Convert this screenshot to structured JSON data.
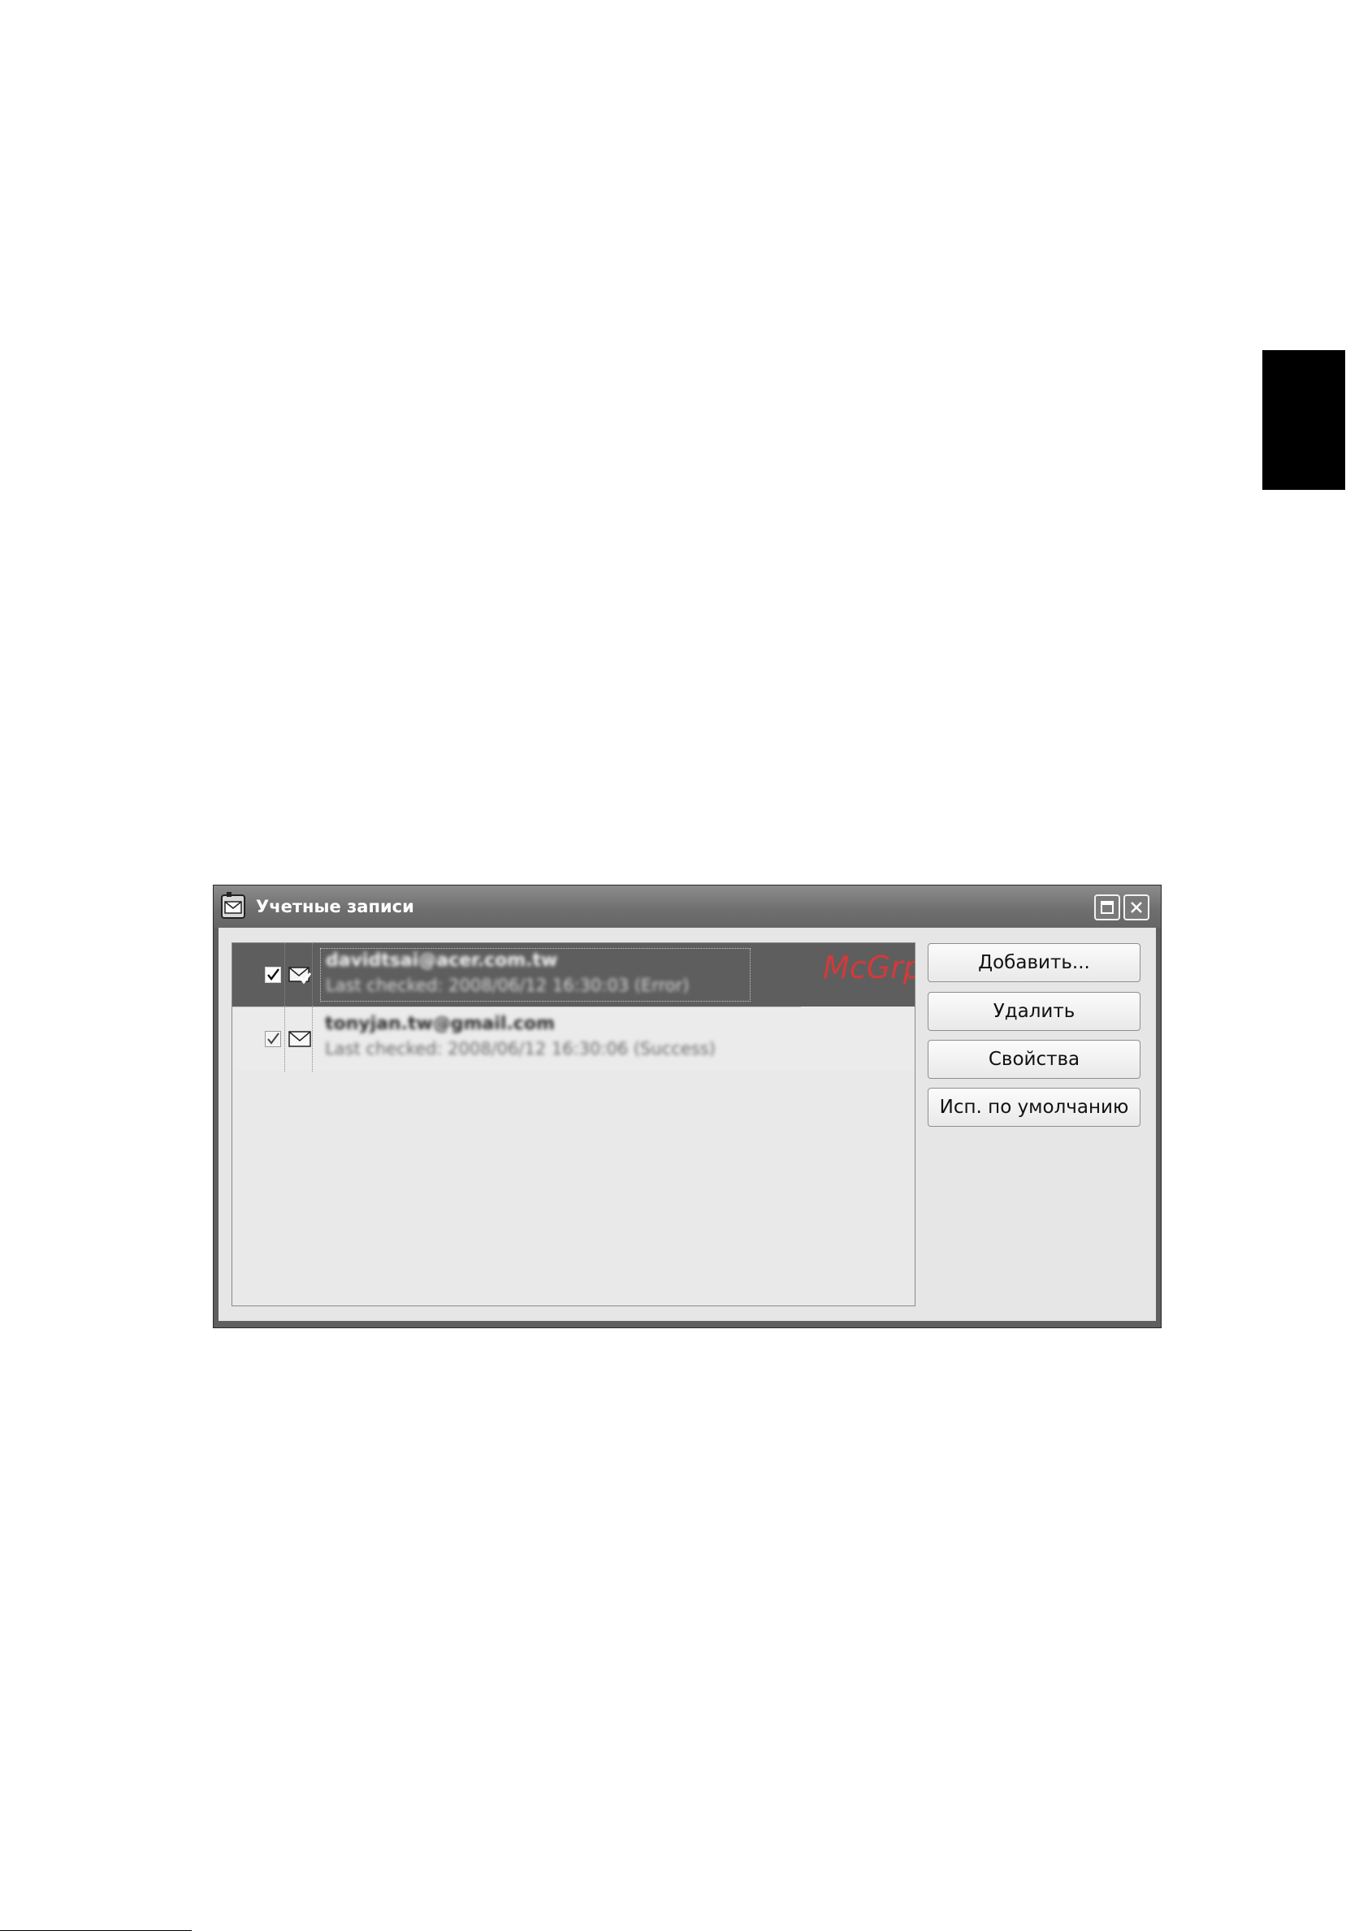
{
  "window": {
    "title": "Учетные записи"
  },
  "accounts": [
    {
      "email": "davidtsai@acer.com.tw",
      "status": "Last checked: 2008/06/12 16:30:03 (Error)",
      "enabled": true,
      "selected": true,
      "icon": "mail-checked-icon"
    },
    {
      "email": "tonyjan.tw@gmail.com",
      "status": "Last checked: 2008/06/12 16:30:06 (Success)",
      "enabled": true,
      "selected": false,
      "icon": "mail-icon"
    }
  ],
  "buttons": {
    "add": "Добавить...",
    "remove": "Удалить",
    "properties": "Свойства",
    "set_default": "Исп. по умолчанию"
  },
  "watermark": "McGrp.Ru",
  "colors": {
    "selection": "#5e5e5e",
    "watermark": "#d23a3a",
    "titlebar": "#777777"
  }
}
